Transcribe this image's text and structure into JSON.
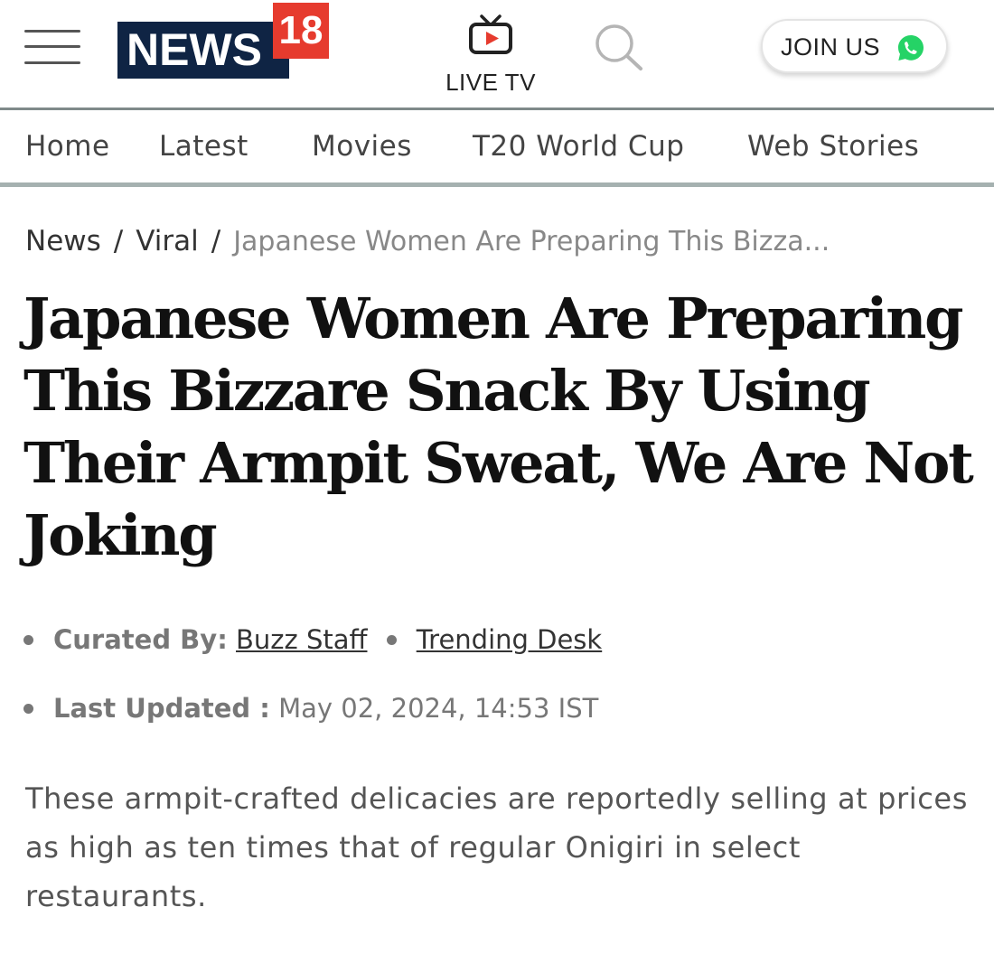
{
  "header": {
    "logo": {
      "word": "NEWS",
      "number": "18"
    },
    "live_tv_label": "LIVE TV",
    "join_label": "JOIN US",
    "colors": {
      "logo_navy": "#0f2444",
      "logo_red": "#e63b2e",
      "live_tv_red": "#e63b2e",
      "whatsapp_green": "#25d366"
    },
    "icons": [
      "hamburger-menu-icon",
      "tv-icon",
      "search-icon",
      "whatsapp-icon"
    ]
  },
  "nav": {
    "items": [
      "Home",
      "Latest",
      "Movies",
      "T20 World Cup",
      "Web Stories"
    ]
  },
  "breadcrumb": {
    "items": [
      "News",
      "Viral"
    ],
    "separator": "/",
    "current": "Japanese Women Are Preparing This Bizza..."
  },
  "article": {
    "headline": "Japanese Women Are Preparing This Bizzare Snack By Using Their Armpit Sweat, We Are Not Joking",
    "curated_by_label": "Curated By:",
    "authors": [
      "Buzz Staff",
      "Trending Desk"
    ],
    "last_updated_label": "Last Updated :",
    "last_updated_value": "May 02, 2024, 14:53 IST",
    "summary": "These armpit-crafted delicacies are reportedly selling at prices as high as ten times that of regular Onigiri in select restaurants."
  }
}
